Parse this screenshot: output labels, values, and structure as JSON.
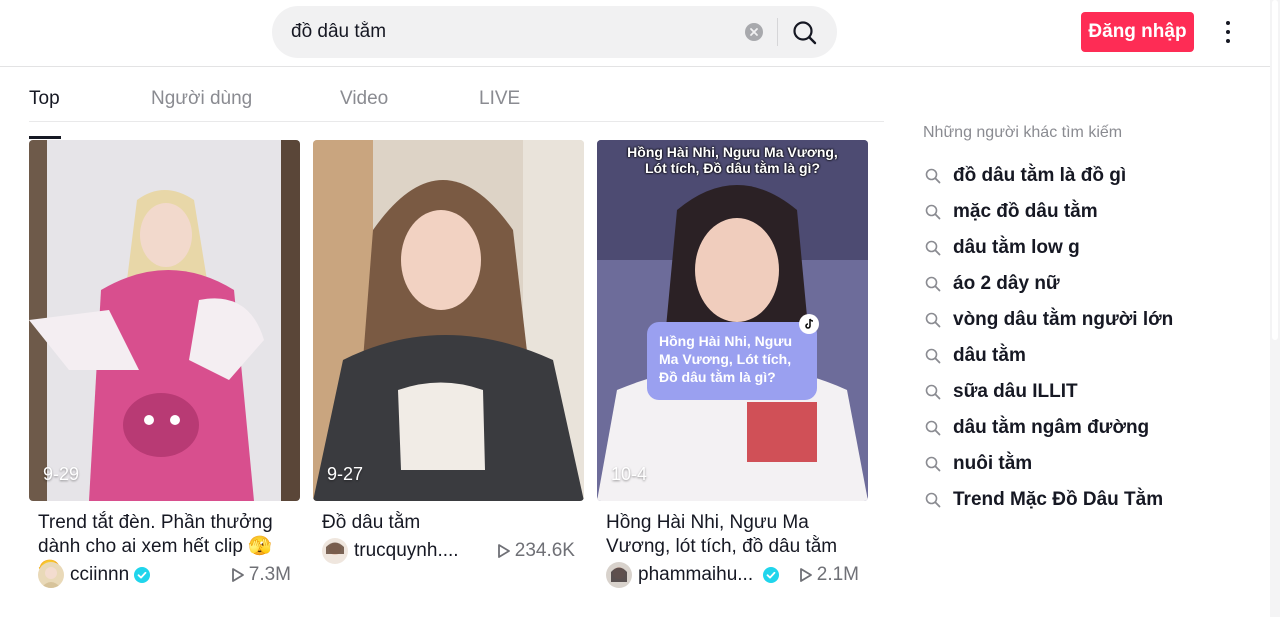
{
  "search": {
    "value": "đồ dâu tằm"
  },
  "header": {
    "login_label": "Đăng nhập"
  },
  "tabs": [
    {
      "label": "Top"
    },
    {
      "label": "Người dùng"
    },
    {
      "label": "Video"
    },
    {
      "label": "LIVE"
    }
  ],
  "videos": [
    {
      "date": "9-29",
      "title": "Trend tắt đèn. Phần thưởng dành cho ai xem hết clip 🫣🫣",
      "user": "cciinnn",
      "verified": true,
      "views": "7.3M"
    },
    {
      "date": "9-27",
      "title": "Đồ dâu tằm",
      "user": "trucquynh....",
      "verified": false,
      "views": "234.6K"
    },
    {
      "date": "10-4",
      "title": "Hồng Hài Nhi, Ngưu Ma Vương, lót tích, đồ dâu tằm l...",
      "user": "phammaihu...",
      "verified": true,
      "views": "2.1M",
      "overlay_top": "Hồng Hài Nhi, Ngưu Ma Vương, Lót tích, Đồ dâu tằm là gì?",
      "overlay_bubble": "Hồng Hài Nhi, Ngưu Ma Vương, Lót tích, Đồ dâu tằm là gì?"
    }
  ],
  "sidebar": {
    "title": "Những người khác tìm kiếm",
    "suggestions": [
      "đồ dâu tằm là đồ gì",
      "mặc đồ dâu tằm",
      "dâu tằm low g",
      "áo 2 dây nữ",
      "vòng dâu tằm người lớn",
      "dâu tằm",
      "sữa dâu ILLIT",
      "dâu tằm ngâm đường",
      "nuôi tằm",
      "Trend Mặc Đồ Dâu Tằm"
    ]
  },
  "colors": {
    "accent": "#fe2c55",
    "verified": "#20d5ec"
  }
}
